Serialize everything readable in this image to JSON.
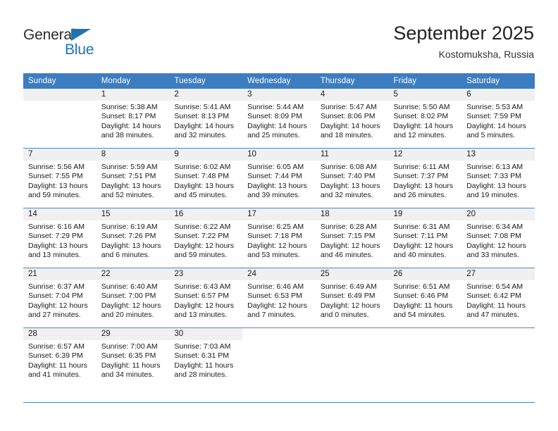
{
  "brand": {
    "line1": "General",
    "line2": "Blue",
    "triangle_color": "#1d72b8",
    "text_color": "#2b2b2b"
  },
  "header": {
    "title": "September 2025",
    "subtitle": "Kostomuksha, Russia"
  },
  "theme": {
    "header_blue": "#3b7dc0",
    "grid_line": "#4b86c2",
    "day_band": "#f0f0f0"
  },
  "weekday_headers": [
    "Sunday",
    "Monday",
    "Tuesday",
    "Wednesday",
    "Thursday",
    "Friday",
    "Saturday"
  ],
  "weeks": [
    [
      {
        "day": "",
        "sunrise": "",
        "sunset": "",
        "daylight_line1": "",
        "daylight_line2": "",
        "empty": true
      },
      {
        "day": "1",
        "sunrise": "Sunrise: 5:38 AM",
        "sunset": "Sunset: 8:17 PM",
        "daylight_line1": "Daylight: 14 hours",
        "daylight_line2": "and 38 minutes."
      },
      {
        "day": "2",
        "sunrise": "Sunrise: 5:41 AM",
        "sunset": "Sunset: 8:13 PM",
        "daylight_line1": "Daylight: 14 hours",
        "daylight_line2": "and 32 minutes."
      },
      {
        "day": "3",
        "sunrise": "Sunrise: 5:44 AM",
        "sunset": "Sunset: 8:09 PM",
        "daylight_line1": "Daylight: 14 hours",
        "daylight_line2": "and 25 minutes."
      },
      {
        "day": "4",
        "sunrise": "Sunrise: 5:47 AM",
        "sunset": "Sunset: 8:06 PM",
        "daylight_line1": "Daylight: 14 hours",
        "daylight_line2": "and 18 minutes."
      },
      {
        "day": "5",
        "sunrise": "Sunrise: 5:50 AM",
        "sunset": "Sunset: 8:02 PM",
        "daylight_line1": "Daylight: 14 hours",
        "daylight_line2": "and 12 minutes."
      },
      {
        "day": "6",
        "sunrise": "Sunrise: 5:53 AM",
        "sunset": "Sunset: 7:59 PM",
        "daylight_line1": "Daylight: 14 hours",
        "daylight_line2": "and 5 minutes."
      }
    ],
    [
      {
        "day": "7",
        "sunrise": "Sunrise: 5:56 AM",
        "sunset": "Sunset: 7:55 PM",
        "daylight_line1": "Daylight: 13 hours",
        "daylight_line2": "and 59 minutes."
      },
      {
        "day": "8",
        "sunrise": "Sunrise: 5:59 AM",
        "sunset": "Sunset: 7:51 PM",
        "daylight_line1": "Daylight: 13 hours",
        "daylight_line2": "and 52 minutes."
      },
      {
        "day": "9",
        "sunrise": "Sunrise: 6:02 AM",
        "sunset": "Sunset: 7:48 PM",
        "daylight_line1": "Daylight: 13 hours",
        "daylight_line2": "and 45 minutes."
      },
      {
        "day": "10",
        "sunrise": "Sunrise: 6:05 AM",
        "sunset": "Sunset: 7:44 PM",
        "daylight_line1": "Daylight: 13 hours",
        "daylight_line2": "and 39 minutes."
      },
      {
        "day": "11",
        "sunrise": "Sunrise: 6:08 AM",
        "sunset": "Sunset: 7:40 PM",
        "daylight_line1": "Daylight: 13 hours",
        "daylight_line2": "and 32 minutes."
      },
      {
        "day": "12",
        "sunrise": "Sunrise: 6:11 AM",
        "sunset": "Sunset: 7:37 PM",
        "daylight_line1": "Daylight: 13 hours",
        "daylight_line2": "and 26 minutes."
      },
      {
        "day": "13",
        "sunrise": "Sunrise: 6:13 AM",
        "sunset": "Sunset: 7:33 PM",
        "daylight_line1": "Daylight: 13 hours",
        "daylight_line2": "and 19 minutes."
      }
    ],
    [
      {
        "day": "14",
        "sunrise": "Sunrise: 6:16 AM",
        "sunset": "Sunset: 7:29 PM",
        "daylight_line1": "Daylight: 13 hours",
        "daylight_line2": "and 13 minutes."
      },
      {
        "day": "15",
        "sunrise": "Sunrise: 6:19 AM",
        "sunset": "Sunset: 7:26 PM",
        "daylight_line1": "Daylight: 13 hours",
        "daylight_line2": "and 6 minutes."
      },
      {
        "day": "16",
        "sunrise": "Sunrise: 6:22 AM",
        "sunset": "Sunset: 7:22 PM",
        "daylight_line1": "Daylight: 12 hours",
        "daylight_line2": "and 59 minutes."
      },
      {
        "day": "17",
        "sunrise": "Sunrise: 6:25 AM",
        "sunset": "Sunset: 7:18 PM",
        "daylight_line1": "Daylight: 12 hours",
        "daylight_line2": "and 53 minutes."
      },
      {
        "day": "18",
        "sunrise": "Sunrise: 6:28 AM",
        "sunset": "Sunset: 7:15 PM",
        "daylight_line1": "Daylight: 12 hours",
        "daylight_line2": "and 46 minutes."
      },
      {
        "day": "19",
        "sunrise": "Sunrise: 6:31 AM",
        "sunset": "Sunset: 7:11 PM",
        "daylight_line1": "Daylight: 12 hours",
        "daylight_line2": "and 40 minutes."
      },
      {
        "day": "20",
        "sunrise": "Sunrise: 6:34 AM",
        "sunset": "Sunset: 7:08 PM",
        "daylight_line1": "Daylight: 12 hours",
        "daylight_line2": "and 33 minutes."
      }
    ],
    [
      {
        "day": "21",
        "sunrise": "Sunrise: 6:37 AM",
        "sunset": "Sunset: 7:04 PM",
        "daylight_line1": "Daylight: 12 hours",
        "daylight_line2": "and 27 minutes."
      },
      {
        "day": "22",
        "sunrise": "Sunrise: 6:40 AM",
        "sunset": "Sunset: 7:00 PM",
        "daylight_line1": "Daylight: 12 hours",
        "daylight_line2": "and 20 minutes."
      },
      {
        "day": "23",
        "sunrise": "Sunrise: 6:43 AM",
        "sunset": "Sunset: 6:57 PM",
        "daylight_line1": "Daylight: 12 hours",
        "daylight_line2": "and 13 minutes."
      },
      {
        "day": "24",
        "sunrise": "Sunrise: 6:46 AM",
        "sunset": "Sunset: 6:53 PM",
        "daylight_line1": "Daylight: 12 hours",
        "daylight_line2": "and 7 minutes."
      },
      {
        "day": "25",
        "sunrise": "Sunrise: 6:49 AM",
        "sunset": "Sunset: 6:49 PM",
        "daylight_line1": "Daylight: 12 hours",
        "daylight_line2": "and 0 minutes."
      },
      {
        "day": "26",
        "sunrise": "Sunrise: 6:51 AM",
        "sunset": "Sunset: 6:46 PM",
        "daylight_line1": "Daylight: 11 hours",
        "daylight_line2": "and 54 minutes."
      },
      {
        "day": "27",
        "sunrise": "Sunrise: 6:54 AM",
        "sunset": "Sunset: 6:42 PM",
        "daylight_line1": "Daylight: 11 hours",
        "daylight_line2": "and 47 minutes."
      }
    ],
    [
      {
        "day": "28",
        "sunrise": "Sunrise: 6:57 AM",
        "sunset": "Sunset: 6:39 PM",
        "daylight_line1": "Daylight: 11 hours",
        "daylight_line2": "and 41 minutes."
      },
      {
        "day": "29",
        "sunrise": "Sunrise: 7:00 AM",
        "sunset": "Sunset: 6:35 PM",
        "daylight_line1": "Daylight: 11 hours",
        "daylight_line2": "and 34 minutes."
      },
      {
        "day": "30",
        "sunrise": "Sunrise: 7:03 AM",
        "sunset": "Sunset: 6:31 PM",
        "daylight_line1": "Daylight: 11 hours",
        "daylight_line2": "and 28 minutes."
      },
      {
        "day": "",
        "sunrise": "",
        "sunset": "",
        "daylight_line1": "",
        "daylight_line2": "",
        "blank": true
      },
      {
        "day": "",
        "sunrise": "",
        "sunset": "",
        "daylight_line1": "",
        "daylight_line2": "",
        "blank": true
      },
      {
        "day": "",
        "sunrise": "",
        "sunset": "",
        "daylight_line1": "",
        "daylight_line2": "",
        "blank": true
      },
      {
        "day": "",
        "sunrise": "",
        "sunset": "",
        "daylight_line1": "",
        "daylight_line2": "",
        "blank": true
      }
    ]
  ]
}
